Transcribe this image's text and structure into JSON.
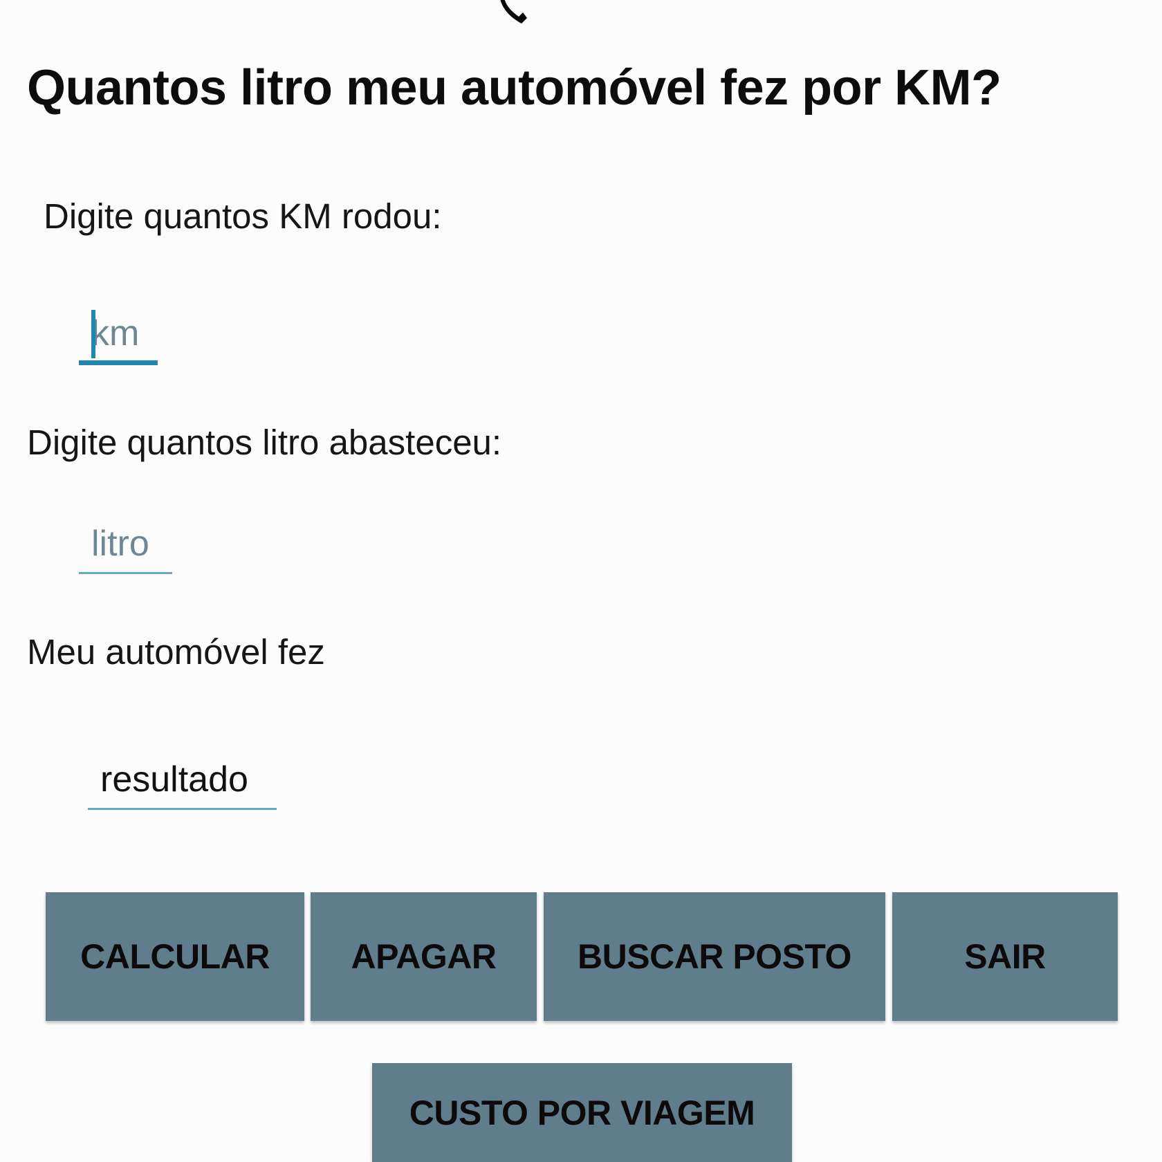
{
  "page": {
    "title": "Quantos litro meu automóvel fez por KM?"
  },
  "form": {
    "km_label": "Digite quantos KM rodou:",
    "km_placeholder": "km",
    "litro_label": "Digite quantos litro abasteceu:",
    "litro_placeholder": "litro",
    "result_label": "Meu automóvel fez",
    "result_placeholder": "resultado"
  },
  "buttons": {
    "calcular": "CALCULAR",
    "apagar": "APAGAR",
    "buscar_posto": "BUSCAR POSTO",
    "sair": "SAIR",
    "custo_por_viagem": "CUSTO POR VIAGEM"
  },
  "colors": {
    "button_bg": "#607d8b",
    "focus_accent": "#1f87b4",
    "field_underline": "#67a9c4"
  },
  "icons": {
    "top_mark": "partial-phone-icon"
  }
}
